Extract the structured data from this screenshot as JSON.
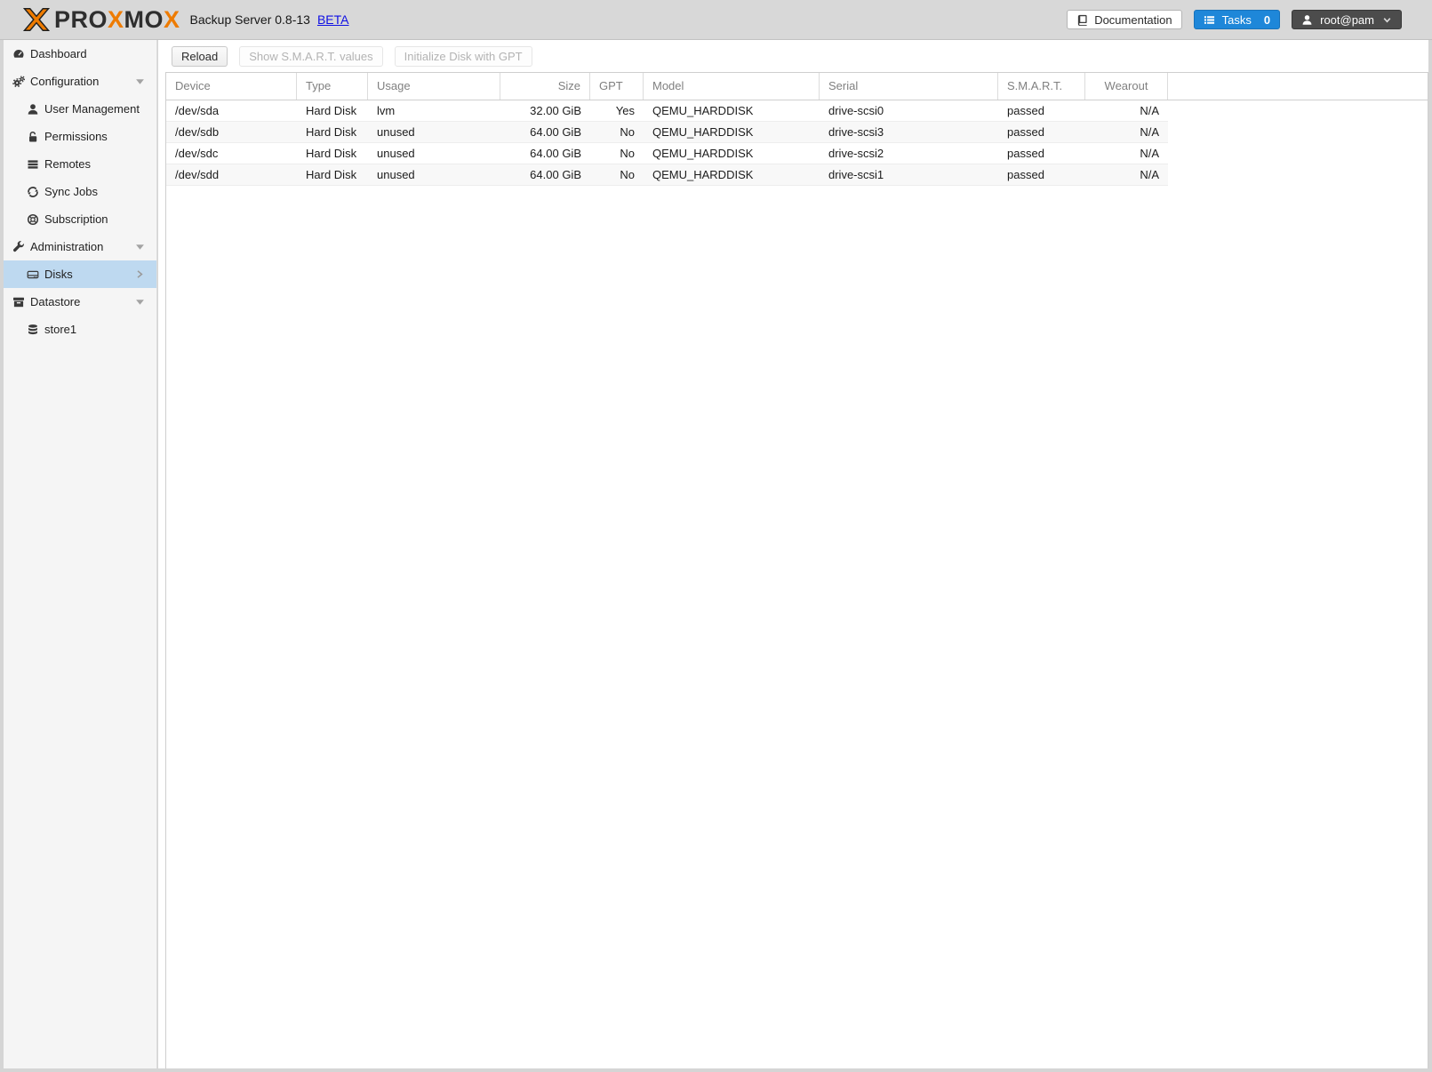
{
  "header": {
    "brand": {
      "pre": "PRO",
      "x1": "X",
      "mid": "MO",
      "x2": "X"
    },
    "title": "Backup Server 0.8-13",
    "beta": "BETA",
    "documentation_label": "Documentation",
    "tasks_label": "Tasks",
    "tasks_count": "0",
    "user_label": "root@pam"
  },
  "sidebar": {
    "items": [
      {
        "label": "Dashboard",
        "icon": "tachometer-icon"
      },
      {
        "label": "Configuration",
        "icon": "gears-icon",
        "expanded": true
      },
      {
        "label": "User Management",
        "icon": "user-icon"
      },
      {
        "label": "Permissions",
        "icon": "unlock-icon"
      },
      {
        "label": "Remotes",
        "icon": "list-bars-icon"
      },
      {
        "label": "Sync Jobs",
        "icon": "sync-icon"
      },
      {
        "label": "Subscription",
        "icon": "life-ring-icon"
      },
      {
        "label": "Administration",
        "icon": "wrench-icon",
        "expanded": true
      },
      {
        "label": "Disks",
        "icon": "hdd-icon",
        "selected": true,
        "has_submenu": true
      },
      {
        "label": "Datastore",
        "icon": "archive-icon",
        "expanded": true
      },
      {
        "label": "store1",
        "icon": "database-icon"
      }
    ]
  },
  "toolbar": {
    "reload_label": "Reload",
    "smart_label": "Show S.M.A.R.T. values",
    "init_gpt_label": "Initialize Disk with GPT",
    "smart_disabled": true,
    "init_gpt_disabled": true
  },
  "table": {
    "columns": [
      "Device",
      "Type",
      "Usage",
      "Size",
      "GPT",
      "Model",
      "Serial",
      "S.M.A.R.T.",
      "Wearout"
    ],
    "rows": [
      [
        "/dev/sda",
        "Hard Disk",
        "lvm",
        "32.00 GiB",
        "Yes",
        "QEMU_HARDDISK",
        "drive-scsi0",
        "passed",
        "N/A"
      ],
      [
        "/dev/sdb",
        "Hard Disk",
        "unused",
        "64.00 GiB",
        "No",
        "QEMU_HARDDISK",
        "drive-scsi3",
        "passed",
        "N/A"
      ],
      [
        "/dev/sdc",
        "Hard Disk",
        "unused",
        "64.00 GiB",
        "No",
        "QEMU_HARDDISK",
        "drive-scsi2",
        "passed",
        "N/A"
      ],
      [
        "/dev/sdd",
        "Hard Disk",
        "unused",
        "64.00 GiB",
        "No",
        "QEMU_HARDDISK",
        "drive-scsi1",
        "passed",
        "N/A"
      ]
    ]
  },
  "colors": {
    "brand_orange": "#ee7b00",
    "accent_blue": "#1e87d9",
    "selected_nav_bg": "#bed9f0",
    "link_blue": "#0f0fe4",
    "user_button_bg": "#4c4c4c"
  }
}
